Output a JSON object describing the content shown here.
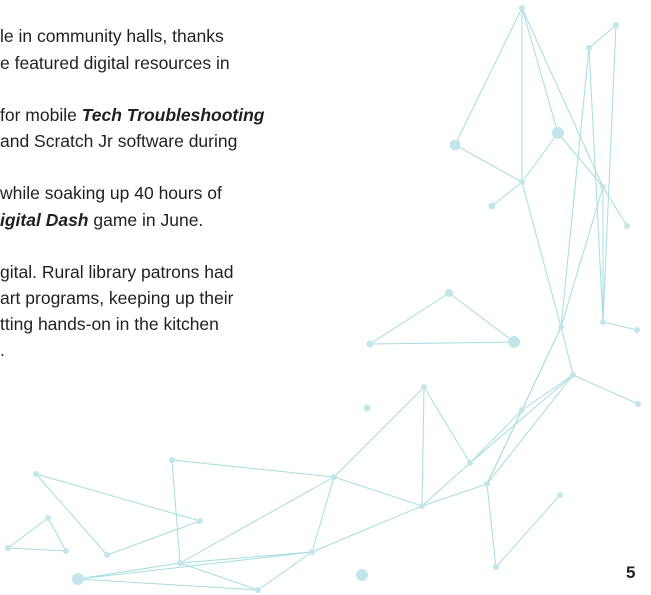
{
  "paragraphs": [
    {
      "lines": [
        {
          "before": "le in community halls, thanks",
          "em": "",
          "after": ""
        },
        {
          "before": "e featured digital resources in",
          "em": "",
          "after": ""
        }
      ]
    },
    {
      "lines": [
        {
          "before": " for mobile ",
          "em": "Tech Troubleshooting",
          "after": ""
        },
        {
          "before": "and Scratch Jr software during",
          "em": "",
          "after": ""
        }
      ]
    },
    {
      "lines": [
        {
          "before": " while soaking up 40 hours of",
          "em": "",
          "after": ""
        },
        {
          "before": "",
          "em": "igital Dash",
          "after": " game in June."
        }
      ]
    },
    {
      "lines": [
        {
          "before": "gital. Rural library patrons had",
          "em": "",
          "after": ""
        },
        {
          "before": " art programs, keeping up their",
          "em": "",
          "after": ""
        },
        {
          "before": "tting hands-on in the kitchen",
          "em": "",
          "after": ""
        },
        {
          "before": ".",
          "em": "",
          "after": ""
        }
      ]
    }
  ],
  "page_number": "5",
  "decoration": {
    "name": "network-constellation",
    "line_color": "#a6dde1",
    "node_color": "#c2e6e9"
  }
}
